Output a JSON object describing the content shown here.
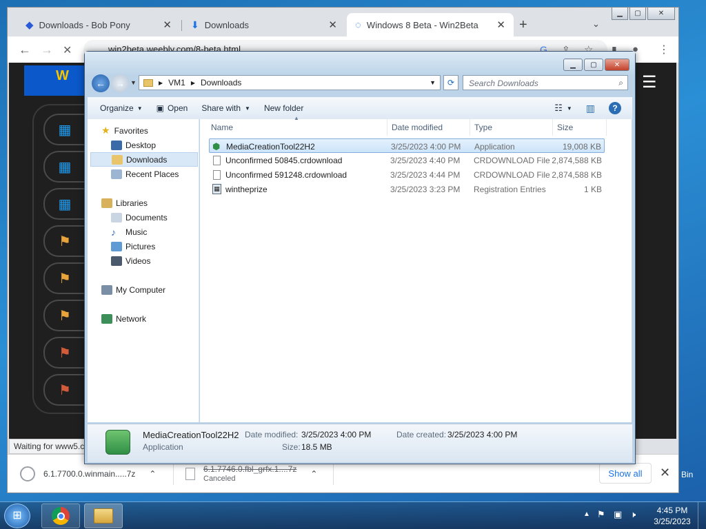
{
  "browser": {
    "tabs": [
      {
        "label": "Downloads - Bob Pony",
        "icon": "bobpony-icon"
      },
      {
        "label": "Downloads",
        "icon": "download-icon"
      },
      {
        "label": "Windows 8 Beta - Win2Beta",
        "icon": "loading-icon"
      }
    ],
    "url": "win2beta.weebly.com/8-beta.html",
    "status_text": "Waiting for www5.c",
    "downloads": [
      {
        "name": "6.1.7700.0.winmain.....7z",
        "status": ""
      },
      {
        "name": "6.1.7746.0.fbl_grfx.1....7z",
        "status": "Canceled"
      }
    ],
    "show_all_label": "Show all"
  },
  "explorer": {
    "breadcrumb": [
      "VM1",
      "Downloads"
    ],
    "search_placeholder": "Search Downloads",
    "toolbar": {
      "organize": "Organize",
      "open": "Open",
      "share_with": "Share with",
      "new_folder": "New folder"
    },
    "nav": {
      "favorites_label": "Favorites",
      "favorites": [
        "Desktop",
        "Downloads",
        "Recent Places"
      ],
      "libraries_label": "Libraries",
      "libraries": [
        "Documents",
        "Music",
        "Pictures",
        "Videos"
      ],
      "computer_label": "My Computer",
      "network_label": "Network"
    },
    "columns": {
      "name": "Name",
      "date": "Date modified",
      "type": "Type",
      "size": "Size"
    },
    "files": [
      {
        "name": "MediaCreationTool22H2",
        "date": "3/25/2023 4:00 PM",
        "type": "Application",
        "size": "19,008 KB"
      },
      {
        "name": "Unconfirmed 50845.crdownload",
        "date": "3/25/2023 4:40 PM",
        "type": "CRDOWNLOAD File",
        "size": "2,874,588 KB"
      },
      {
        "name": "Unconfirmed 591248.crdownload",
        "date": "3/25/2023 4:44 PM",
        "type": "CRDOWNLOAD File",
        "size": "2,874,588 KB"
      },
      {
        "name": "wintheprize",
        "date": "3/25/2023 3:23 PM",
        "type": "Registration Entries",
        "size": "1 KB"
      }
    ],
    "details": {
      "name": "MediaCreationTool22H2",
      "type": "Application",
      "date_modified_label": "Date modified:",
      "date_modified": "3/25/2023 4:00 PM",
      "date_created_label": "Date created:",
      "date_created": "3/25/2023 4:00 PM",
      "size_label": "Size:",
      "size": "18.5 MB"
    }
  },
  "taskbar": {
    "time": "4:45 PM",
    "date": "3/25/2023",
    "recycle_bin_label": "Bin"
  },
  "colors": {
    "accent": "#1a73e8",
    "selection": "#cce4f9",
    "taskbar": "#1e466e"
  }
}
